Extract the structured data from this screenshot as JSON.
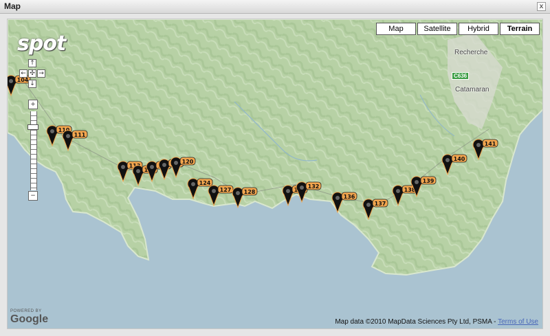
{
  "window": {
    "title": "Map",
    "close_glyph": "x"
  },
  "map_types": [
    {
      "label": "Map",
      "selected": false
    },
    {
      "label": "Satellite",
      "selected": false
    },
    {
      "label": "Hybrid",
      "selected": false
    },
    {
      "label": "Terrain",
      "selected": true
    }
  ],
  "logo": "spot",
  "places": [
    {
      "label": "Recherche"
    },
    {
      "label": "Catamaran"
    }
  ],
  "road_shield": "C636",
  "attribution": {
    "text": "Map data ©2010 MapData Sciences Pty Ltd, PSMA - ",
    "link": "Terms of Use"
  },
  "powered_by": {
    "small": "POWERED BY",
    "brand": "Google"
  },
  "colors": {
    "water": "#aac3d1",
    "land": "#b9d3a8",
    "marker": "#111111",
    "label": "#f3a64e"
  },
  "markers": [
    "104",
    "110",
    "111",
    "113",
    "114",
    "115",
    "117",
    "120",
    "124",
    "127",
    "128",
    "133",
    "132",
    "136",
    "137",
    "138",
    "139",
    "140",
    "141"
  ]
}
